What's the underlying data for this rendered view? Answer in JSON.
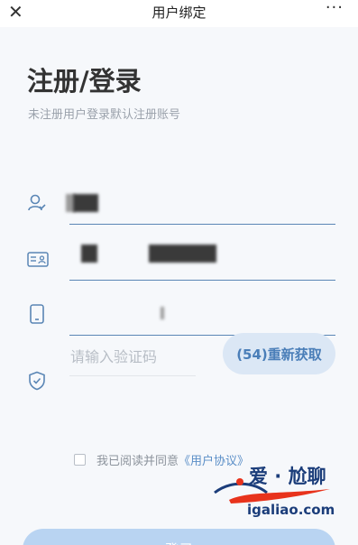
{
  "header": {
    "title": "用户绑定",
    "close_glyph": "✕",
    "more_glyph": "···"
  },
  "main": {
    "heading": "注册/登录",
    "subheading": "未注册用户登录默认注册账号",
    "fields": [
      {
        "icon": "user-icon",
        "value": "(redacted)"
      },
      {
        "icon": "id-card-icon",
        "value": "(redacted)"
      },
      {
        "icon": "phone-icon",
        "value": "(redacted)"
      }
    ],
    "code_field": {
      "icon": "shield-icon",
      "placeholder": "请输入验证码"
    },
    "resend_button": "(54)重新获取",
    "agreement": {
      "prefix": "我已阅读并同意",
      "link": "《用户协议》"
    },
    "submit_label": "登录"
  },
  "watermark": {
    "line1": "爱 · 尬聊",
    "line2": "igaliao.com",
    "color": "#1b3d7a",
    "accent": "#e8331c"
  },
  "colors": {
    "accent": "#4a7eb8",
    "background": "#f6f8fb",
    "resend_bg": "#dbe7f5",
    "submit_bg": "#b9d4f2"
  }
}
